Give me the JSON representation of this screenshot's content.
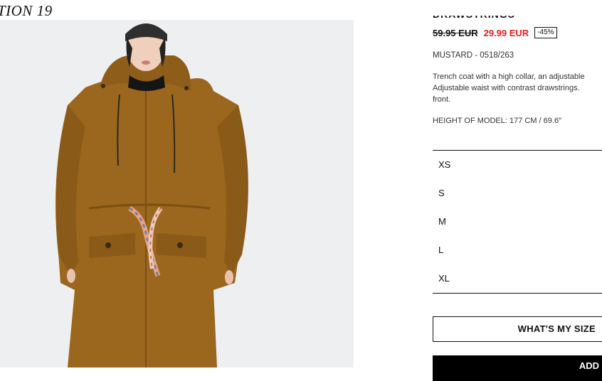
{
  "collection_label": "TION 19",
  "product": {
    "title": "DRAWSTRINGS",
    "old_price": "59.95 EUR",
    "new_price": "29.99 EUR",
    "discount": "-45%",
    "color_ref": "MUSTARD - 0518/263",
    "description": "Trench coat with a high collar, an adjustable\nAdjustable waist with contrast drawstrings.\nfront.",
    "model_height": "HEIGHT OF MODEL: 177 CM / 69.6″"
  },
  "sizes": [
    "XS",
    "S",
    "M",
    "L",
    "XL"
  ],
  "buttons": {
    "whats_my_size": "WHAT'S MY SIZE",
    "add": "ADD"
  },
  "colors": {
    "coat": "#9b661d",
    "sale_red": "#e0221f",
    "background": "#eeeff1"
  }
}
